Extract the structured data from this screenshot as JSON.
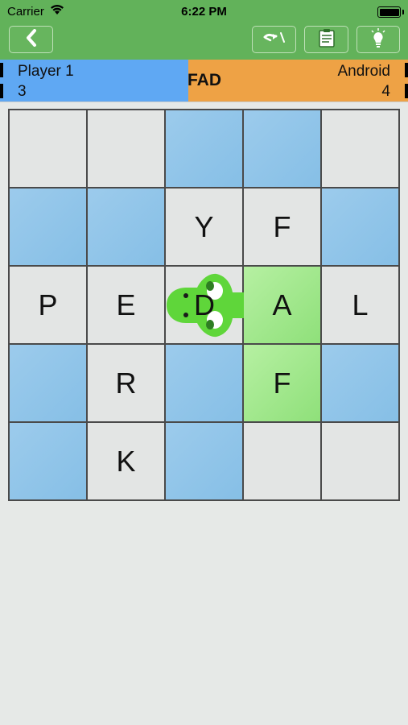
{
  "status_bar": {
    "carrier": "Carrier",
    "time": "6:22 PM"
  },
  "nav": {
    "back_icon": "chevron-left-icon",
    "swap_icon": "swap-icon",
    "notes_icon": "notes-icon",
    "hint_icon": "lightbulb-icon"
  },
  "scoreboard": {
    "player1": {
      "name": "Player 1",
      "score": "3",
      "color": "#5fa8f3"
    },
    "player2": {
      "name": "Android",
      "score": "4",
      "color": "#eea245"
    },
    "current_word": "FAD"
  },
  "board": {
    "size": 5,
    "cells": [
      {
        "letter": "",
        "state": "empty"
      },
      {
        "letter": "",
        "state": "empty"
      },
      {
        "letter": "",
        "state": "blue"
      },
      {
        "letter": "",
        "state": "blue"
      },
      {
        "letter": "",
        "state": "empty"
      },
      {
        "letter": "",
        "state": "blue"
      },
      {
        "letter": "",
        "state": "blue"
      },
      {
        "letter": "Y",
        "state": "empty"
      },
      {
        "letter": "F",
        "state": "empty"
      },
      {
        "letter": "",
        "state": "blue"
      },
      {
        "letter": "P",
        "state": "empty"
      },
      {
        "letter": "E",
        "state": "empty"
      },
      {
        "letter": "D",
        "state": "cursor"
      },
      {
        "letter": "A",
        "state": "green"
      },
      {
        "letter": "L",
        "state": "empty"
      },
      {
        "letter": "",
        "state": "blue"
      },
      {
        "letter": "R",
        "state": "empty"
      },
      {
        "letter": "",
        "state": "blue"
      },
      {
        "letter": "F",
        "state": "green"
      },
      {
        "letter": "",
        "state": "blue"
      },
      {
        "letter": "",
        "state": "blue"
      },
      {
        "letter": "K",
        "state": "empty"
      },
      {
        "letter": "",
        "state": "blue"
      },
      {
        "letter": "",
        "state": "empty"
      },
      {
        "letter": "",
        "state": "empty"
      }
    ],
    "cursor_icon": "crocodile-icon"
  }
}
